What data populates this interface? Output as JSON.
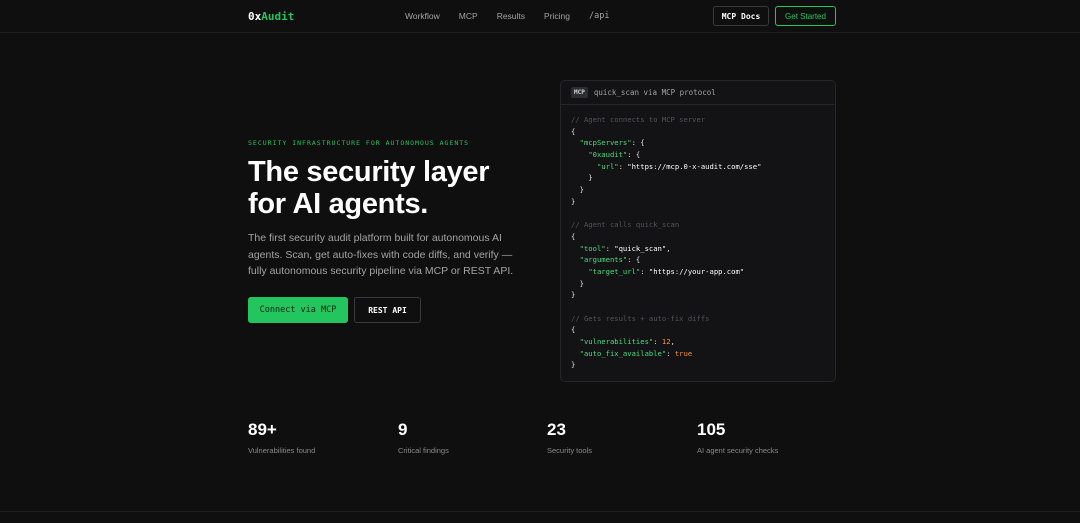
{
  "nav": {
    "logo_prefix": "0x",
    "logo_suffix": "Audit",
    "links": [
      "Workflow",
      "MCP",
      "Results",
      "Pricing",
      "/api"
    ],
    "docs_button": "MCP Docs",
    "start_button": "Get Started"
  },
  "hero": {
    "eyebrow": "SECURITY INFRASTRUCTURE FOR AUTONOMOUS AGENTS",
    "headline_line1": "The security layer",
    "headline_line2": "for AI agents.",
    "subcopy": "The first security audit platform built for autonomous AI agents. Scan, get auto-fixes with code diffs, and verify — fully autonomous security pipeline via MCP or REST API.",
    "primary_button": "Connect via MCP",
    "secondary_button": "REST API"
  },
  "code_card": {
    "tag": "MCP",
    "title": "quick_scan via MCP protocol",
    "lines": [
      [
        {
          "t": "// Agent connects to MCP server",
          "c": "com"
        }
      ],
      [
        {
          "t": "{",
          "c": "pun"
        }
      ],
      [
        {
          "t": "  ",
          "c": "pun"
        },
        {
          "t": "\"mcpServers\"",
          "c": "key"
        },
        {
          "t": ": {",
          "c": "pun"
        }
      ],
      [
        {
          "t": "    ",
          "c": "pun"
        },
        {
          "t": "\"0xaudit\"",
          "c": "key"
        },
        {
          "t": ": {",
          "c": "pun"
        }
      ],
      [
        {
          "t": "      ",
          "c": "pun"
        },
        {
          "t": "\"url\"",
          "c": "key"
        },
        {
          "t": ": ",
          "c": "pun"
        },
        {
          "t": "\"https://mcp.0-x-audit.com/sse\"",
          "c": "str"
        }
      ],
      [
        {
          "t": "    }",
          "c": "pun"
        }
      ],
      [
        {
          "t": "  }",
          "c": "pun"
        }
      ],
      [
        {
          "t": "}",
          "c": "pun"
        }
      ],
      [
        {
          "t": "",
          "c": "pun"
        }
      ],
      [
        {
          "t": "// Agent calls quick_scan",
          "c": "com"
        }
      ],
      [
        {
          "t": "{",
          "c": "pun"
        }
      ],
      [
        {
          "t": "  ",
          "c": "pun"
        },
        {
          "t": "\"tool\"",
          "c": "key"
        },
        {
          "t": ": ",
          "c": "pun"
        },
        {
          "t": "\"quick_scan\"",
          "c": "str"
        },
        {
          "t": ",",
          "c": "pun"
        }
      ],
      [
        {
          "t": "  ",
          "c": "pun"
        },
        {
          "t": "\"arguments\"",
          "c": "key"
        },
        {
          "t": ": {",
          "c": "pun"
        }
      ],
      [
        {
          "t": "    ",
          "c": "pun"
        },
        {
          "t": "\"target_url\"",
          "c": "key"
        },
        {
          "t": ": ",
          "c": "pun"
        },
        {
          "t": "\"https://your-app.com\"",
          "c": "str"
        }
      ],
      [
        {
          "t": "  }",
          "c": "pun"
        }
      ],
      [
        {
          "t": "}",
          "c": "pun"
        }
      ],
      [
        {
          "t": "",
          "c": "pun"
        }
      ],
      [
        {
          "t": "// Gets results + auto-fix diffs",
          "c": "com"
        }
      ],
      [
        {
          "t": "{",
          "c": "pun"
        }
      ],
      [
        {
          "t": "  ",
          "c": "pun"
        },
        {
          "t": "\"vulnerabilities\"",
          "c": "key"
        },
        {
          "t": ": ",
          "c": "pun"
        },
        {
          "t": "12",
          "c": "num"
        },
        {
          "t": ",",
          "c": "pun"
        }
      ],
      [
        {
          "t": "  ",
          "c": "pun"
        },
        {
          "t": "\"auto_fix_available\"",
          "c": "key"
        },
        {
          "t": ": ",
          "c": "pun"
        },
        {
          "t": "true",
          "c": "num"
        }
      ],
      [
        {
          "t": "}",
          "c": "pun"
        }
      ]
    ]
  },
  "stats": [
    {
      "value": "89+",
      "label": "Vulnerabilities found"
    },
    {
      "value": "9",
      "label": "Critical findings"
    },
    {
      "value": "23",
      "label": "Security tools"
    },
    {
      "value": "105",
      "label": "AI agent security checks"
    }
  ],
  "colors": {
    "accent": "#22c55e",
    "background": "#0f0f10",
    "card": "#131315"
  }
}
